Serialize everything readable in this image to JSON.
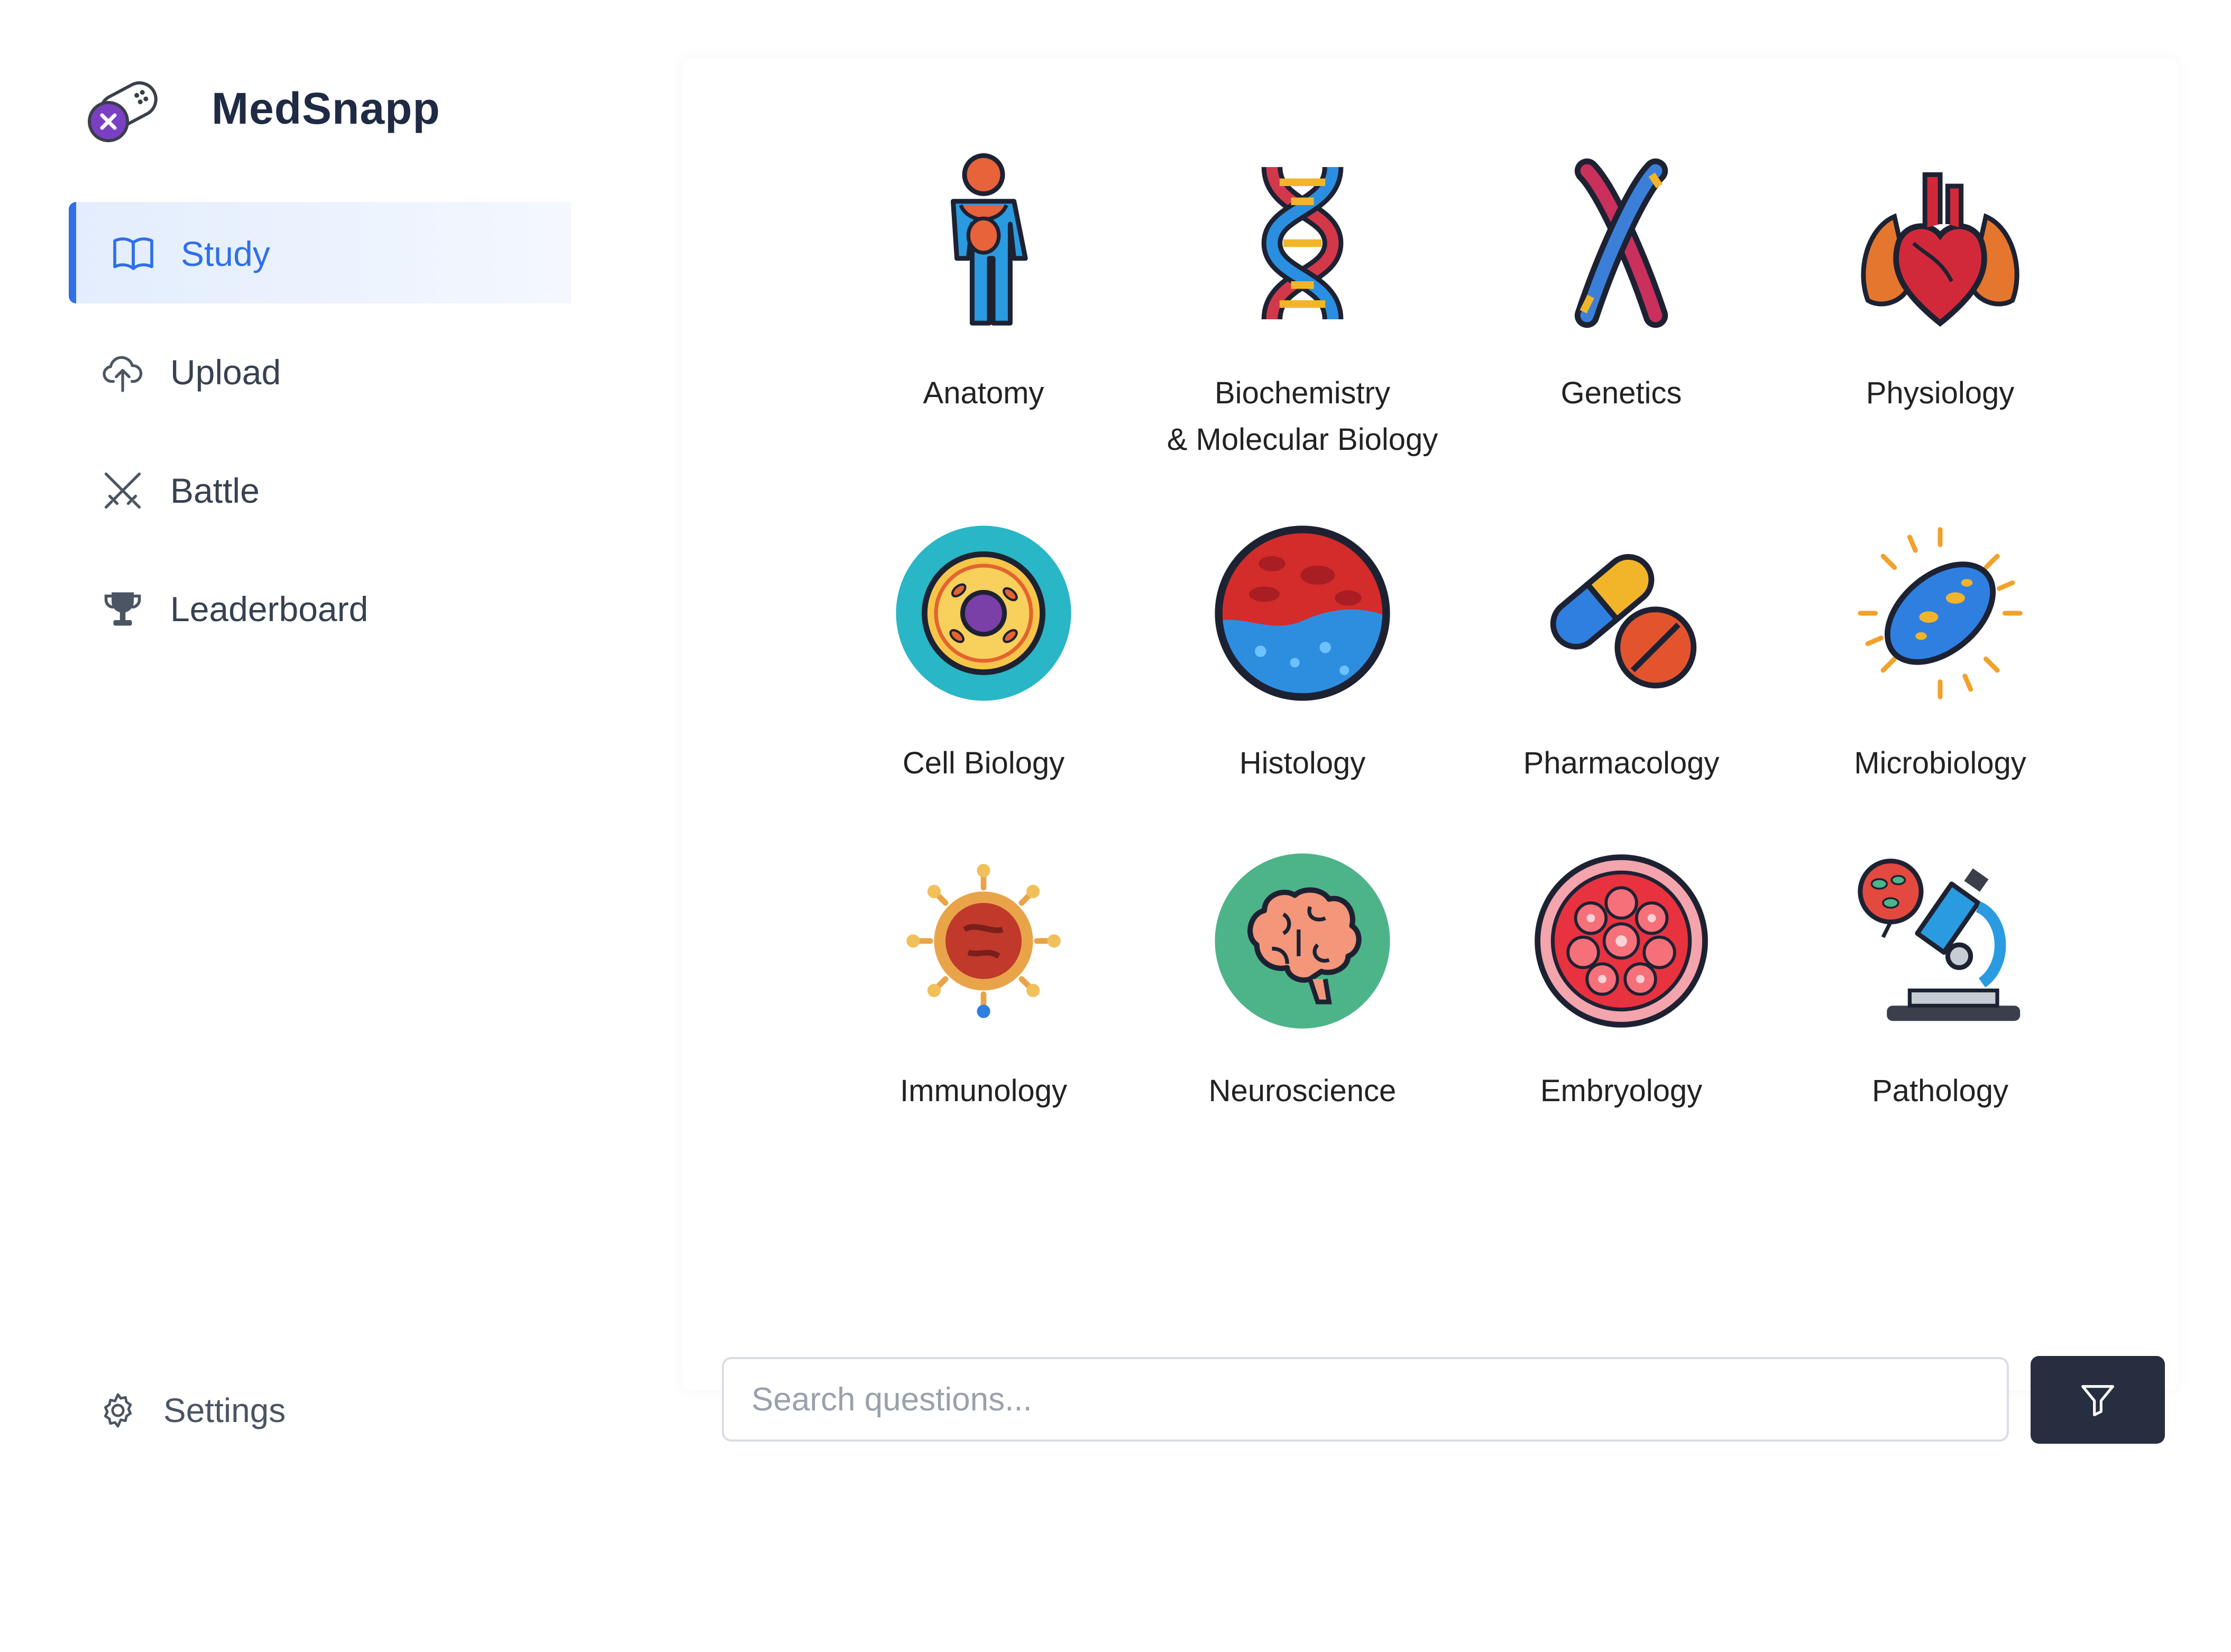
{
  "app": {
    "name": "MedSnapp"
  },
  "sidebar": {
    "items": [
      {
        "label": "Study",
        "icon": "book-open-icon",
        "active": true
      },
      {
        "label": "Upload",
        "icon": "cloud-upload-icon",
        "active": false
      },
      {
        "label": "Battle",
        "icon": "crossed-swords-icon",
        "active": false
      },
      {
        "label": "Leaderboard",
        "icon": "trophy-icon",
        "active": false
      }
    ],
    "settings": {
      "label": "Settings",
      "icon": "gear-icon"
    }
  },
  "subjects": [
    {
      "label": "Anatomy",
      "icon": "human-body-icon"
    },
    {
      "label": "Biochemistry\n& Molecular Biology",
      "icon": "dna-helix-icon"
    },
    {
      "label": "Genetics",
      "icon": "chromosome-icon"
    },
    {
      "label": "Physiology",
      "icon": "heart-lungs-icon"
    },
    {
      "label": "Cell Biology",
      "icon": "cell-icon"
    },
    {
      "label": "Histology",
      "icon": "tissue-icon"
    },
    {
      "label": "Pharmacology",
      "icon": "pills-icon"
    },
    {
      "label": "Microbiology",
      "icon": "bacterium-icon"
    },
    {
      "label": "Immunology",
      "icon": "virus-icon"
    },
    {
      "label": "Neuroscience",
      "icon": "brain-icon"
    },
    {
      "label": "Embryology",
      "icon": "embryo-icon"
    },
    {
      "label": "Pathology",
      "icon": "microscope-icon"
    }
  ],
  "search": {
    "placeholder": "Search questions...",
    "value": ""
  },
  "filter": {
    "icon": "filter-icon"
  },
  "colors": {
    "accent": "#2f6fe8",
    "dark_button": "#262e3f",
    "brand_text": "#1f2a44"
  }
}
